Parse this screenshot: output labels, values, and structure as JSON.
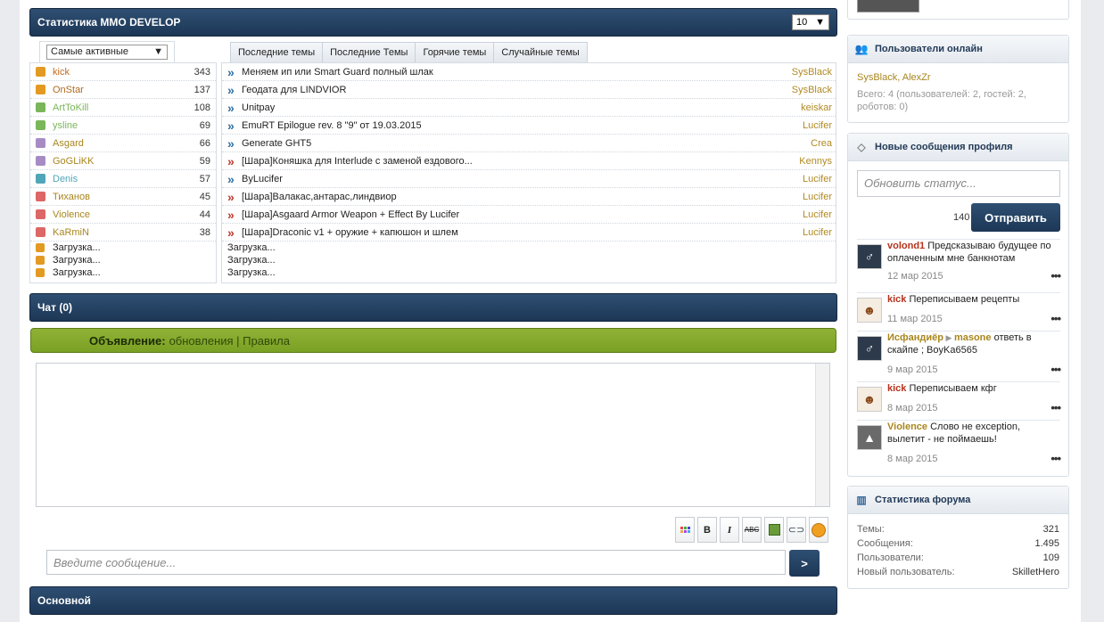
{
  "stats": {
    "title": "Статистика MMO DEVELOP",
    "count_select": "10",
    "users_select": "Самые активные",
    "users": [
      {
        "name": "kick",
        "count": "343",
        "color": "#c56a1b",
        "icon": "#e39a22"
      },
      {
        "name": "OnStar",
        "count": "137",
        "color": "#b06a20",
        "icon": "#e39a22"
      },
      {
        "name": "ArtToKill",
        "count": "108",
        "color": "#7ab65a",
        "icon": "#7ab65a"
      },
      {
        "name": "ysline",
        "count": "69",
        "color": "#7ab65a",
        "icon": "#7ab65a"
      },
      {
        "name": "Asgard",
        "count": "66",
        "color": "#a9861d",
        "icon": "#a78bc4"
      },
      {
        "name": "GoGLiKK",
        "count": "59",
        "color": "#a9861d",
        "icon": "#a78bc4"
      },
      {
        "name": "Denis",
        "count": "57",
        "color": "#4fa6b8",
        "icon": "#4fa6b8"
      },
      {
        "name": "Тиханов",
        "count": "45",
        "color": "#a9861d",
        "icon": "#d66"
      },
      {
        "name": "Violence",
        "count": "44",
        "color": "#a9861d",
        "icon": "#d66"
      },
      {
        "name": "KaRmiN",
        "count": "38",
        "color": "#a9861d",
        "icon": "#d66"
      }
    ],
    "loading": [
      "Загрузка...",
      "Загрузка...",
      "Загрузка..."
    ],
    "tabs": [
      "Последние темы",
      "Последние Темы",
      "Горячие темы",
      "Случайные темы"
    ],
    "topics": [
      {
        "title": "Меняем ип или Smart Guard полный шлак",
        "author": "SysBlack",
        "arrow_color": "#2e6fa3"
      },
      {
        "title": "Геодата для LINDVIOR",
        "author": "SysBlack",
        "arrow_color": "#2e6fa3"
      },
      {
        "title": "Unitpay",
        "author": "keiskar",
        "arrow_color": "#2e6fa3"
      },
      {
        "title": "EmuRT Epilogue rev. 8 \"9\" от 19.03.2015",
        "author": "Lucifer",
        "arrow_color": "#2e6fa3"
      },
      {
        "title": "Generate GHT5",
        "author": "Crea",
        "arrow_color": "#2e6fa3"
      },
      {
        "title": "[Шара]Коняшка для Interlude с заменой ездового...",
        "author": "Kennys",
        "arrow_color": "#c0392b"
      },
      {
        "title": "ByLucifer",
        "author": "Lucifer",
        "arrow_color": "#2e6fa3"
      },
      {
        "title": "[Шара]Валакас,антарас,линдвиор",
        "author": "Lucifer",
        "arrow_color": "#c0392b"
      },
      {
        "title": "[Шара]Asgaard Armor Weapon + Effect By Lucifer",
        "author": "Lucifer",
        "arrow_color": "#c0392b"
      },
      {
        "title": "[Шара]Draconic v1 + оружие + капюшон и шлем",
        "author": "Lucifer",
        "arrow_color": "#c0392b"
      }
    ],
    "topic_loading": [
      "Загрузка...",
      "Загрузка...",
      "Загрузка..."
    ]
  },
  "chat": {
    "title": "Чат (0)",
    "announce_label": "Объявление:",
    "announce_links": "обновления | Правила",
    "placeholder": "Введите сообщение...",
    "send_label": ">",
    "toolbar": [
      "colors-icon",
      "B",
      "I",
      "ABC",
      "image-icon",
      "link-icon",
      "smiley-icon"
    ]
  },
  "main_section": {
    "title": "Основной"
  },
  "sidebar": {
    "online": {
      "title": "Пользователи онлайн",
      "users": "SysBlack, AlexZr",
      "summary": "Всего: 4 (пользователей: 2, гостей: 2, роботов: 0)"
    },
    "profile_posts": {
      "title": "Новые сообщения профиля",
      "placeholder": "Обновить статус...",
      "counter": "140",
      "send_label": "Отправить",
      "posts": [
        {
          "author": "volond1",
          "target": "",
          "text": "Предсказываю будущее по оплаченным мне банкнотам",
          "date": "12 мар 2015",
          "author_color": "red"
        },
        {
          "author": "kick",
          "target": "",
          "text": "Переписываем рецепты",
          "date": "11 мар 2015",
          "author_color": "red"
        },
        {
          "author": "Исфандиёр",
          "target": "masone",
          "text": "ответь в скайпе ; BoyKa6565",
          "date": "9 мар 2015",
          "author_color": "olive"
        },
        {
          "author": "kick",
          "target": "",
          "text": "Переписываем кфг",
          "date": "8 мар 2015",
          "author_color": "red"
        },
        {
          "author": "Violence",
          "target": "",
          "text": "Слово не exception, вылетит - не поймаешь!",
          "date": "8 мар 2015",
          "author_color": "olive"
        }
      ]
    },
    "forum_stats": {
      "title": "Статистика форума",
      "rows": [
        {
          "label": "Темы:",
          "value": "321"
        },
        {
          "label": "Сообщения:",
          "value": "1.495"
        },
        {
          "label": "Пользователи:",
          "value": "109"
        },
        {
          "label": "Новый пользователь:",
          "value": "SkilletHero"
        }
      ]
    }
  }
}
